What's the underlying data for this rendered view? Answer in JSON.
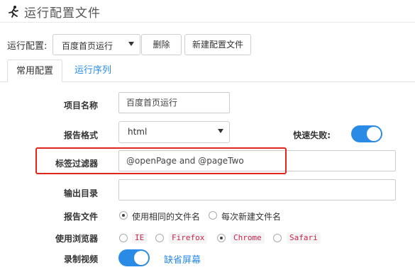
{
  "window": {
    "title": "运行配置文件",
    "icon": "running-person-icon"
  },
  "toolbar": {
    "label": "运行配置:",
    "config_select_value": "百度首页运行",
    "delete_label": "删除",
    "new_config_label": "新建配置文件"
  },
  "tabs": [
    {
      "label": "常用配置",
      "active": true
    },
    {
      "label": "运行序列",
      "active": false
    }
  ],
  "form": {
    "project_name": {
      "label": "项目名称",
      "value": "百度首页运行"
    },
    "report_format": {
      "label": "报告格式",
      "value": "html"
    },
    "fast_fail": {
      "label": "快速失败:",
      "on": true
    },
    "tag_filter": {
      "label": "标签过滤器",
      "value": "@openPage and @pageTwo"
    },
    "output_dir": {
      "label": "输出目录",
      "value": ""
    },
    "report_file": {
      "label": "报告文件",
      "options": [
        {
          "label": "使用相同的文件名",
          "checked": true
        },
        {
          "label": "每次新建文件名",
          "checked": false
        }
      ]
    },
    "browser": {
      "label": "使用浏览器",
      "options": [
        {
          "label": "IE",
          "checked": false
        },
        {
          "label": "Firefox",
          "checked": false
        },
        {
          "label": "Chrome",
          "checked": true
        },
        {
          "label": "Safari",
          "checked": false
        }
      ]
    },
    "record_video": {
      "label": "录制视频",
      "on": true,
      "link": "缺省屏幕"
    }
  },
  "colors": {
    "accent": "#2a8be6",
    "highlight": "#e0251d",
    "code": "#c7254e"
  }
}
